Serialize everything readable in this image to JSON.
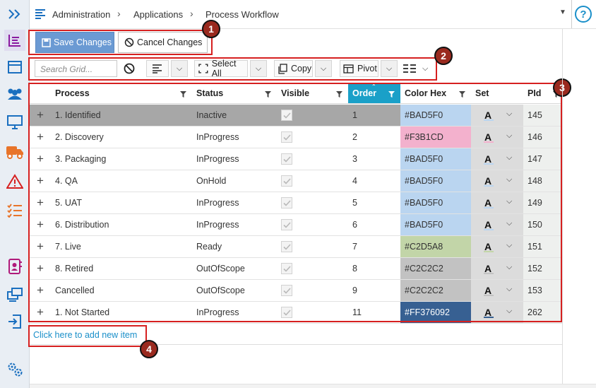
{
  "breadcrumb": [
    "Administration",
    "Applications",
    "Process Workflow"
  ],
  "actions": {
    "save": "Save Changes",
    "cancel": "Cancel Changes"
  },
  "toolbar": {
    "search_placeholder": "Search Grid...",
    "select_all": "Select All",
    "copy": "Copy",
    "pivot": "Pivot"
  },
  "columns": [
    "Process",
    "Status",
    "Visible",
    "Order",
    "Color Hex",
    "Set",
    "PId"
  ],
  "rows": [
    {
      "process": "1. Identified",
      "status": "Inactive",
      "order": "1",
      "color": "#BAD5F0",
      "pid": "145"
    },
    {
      "process": "2. Discovery",
      "status": "InProgress",
      "order": "2",
      "color": "#F3B1CD",
      "pid": "146"
    },
    {
      "process": "3. Packaging",
      "status": "InProgress",
      "order": "3",
      "color": "#BAD5F0",
      "pid": "147"
    },
    {
      "process": "4. QA",
      "status": "OnHold",
      "order": "4",
      "color": "#BAD5F0",
      "pid": "148"
    },
    {
      "process": "5. UAT",
      "status": "InProgress",
      "order": "5",
      "color": "#BAD5F0",
      "pid": "149"
    },
    {
      "process": "6. Distribution",
      "status": "InProgress",
      "order": "6",
      "color": "#BAD5F0",
      "pid": "150"
    },
    {
      "process": "7. Live",
      "status": "Ready",
      "order": "7",
      "color": "#C2D5A8",
      "pid": "151"
    },
    {
      "process": "8. Retired",
      "status": "OutOfScope",
      "order": "8",
      "color": "#C2C2C2",
      "pid": "152"
    },
    {
      "process": "Cancelled",
      "status": "OutOfScope",
      "order": "9",
      "color": "#C2C2C2",
      "pid": "153"
    },
    {
      "process": "1. Not Started",
      "status": "InProgress",
      "order": "11",
      "color": "#FF376092",
      "pid": "262"
    }
  ],
  "row_swatches": [
    "#BAD5F0",
    "#F3B1CD",
    "#BAD5F0",
    "#BAD5F0",
    "#BAD5F0",
    "#BAD5F0",
    "#C2D5A8",
    "#C2C2C2",
    "#C2C2C2",
    "#376092"
  ],
  "set_letter": "A",
  "add_new": "Click here to add new item",
  "callouts": [
    "1",
    "2",
    "3",
    "4"
  ],
  "colors": {
    "accent": "#1aa0c8",
    "callout": "#d62020",
    "badge": "#9a2a1f",
    "selected_row": "#a7a7a7"
  }
}
